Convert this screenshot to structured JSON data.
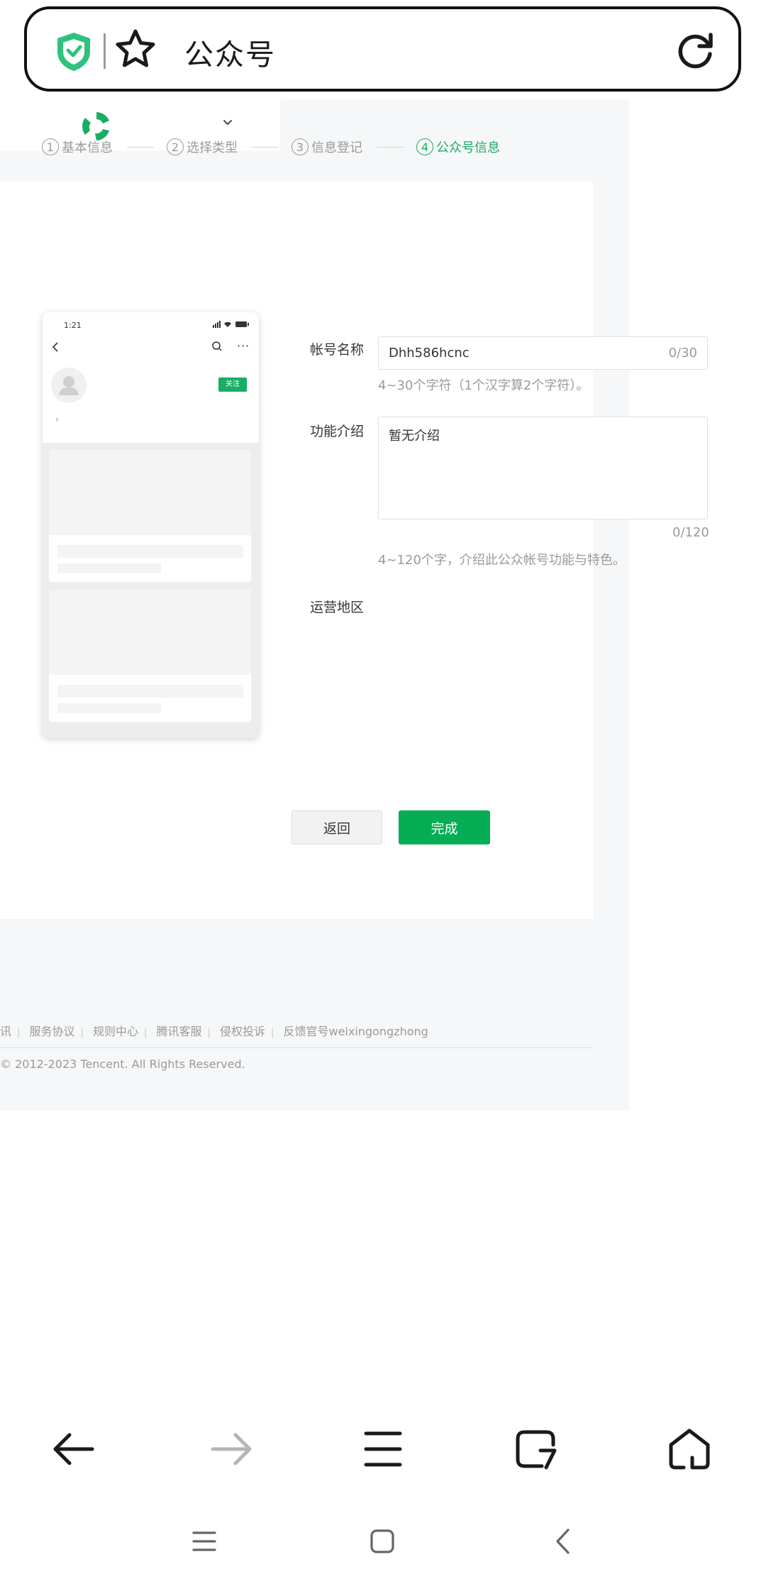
{
  "browser": {
    "address_title": "公众号"
  },
  "steps": [
    {
      "num": "1",
      "label": "基本信息"
    },
    {
      "num": "2",
      "label": "选择类型"
    },
    {
      "num": "3",
      "label": "信息登记"
    },
    {
      "num": "4",
      "label": "公众号信息"
    }
  ],
  "phone_preview": {
    "time": "1:21",
    "follow_label": "关注",
    "chevron": "›"
  },
  "form": {
    "account_name_label": "帐号名称",
    "account_name_value": "Dhh586hcnc",
    "account_name_count": "0/30",
    "account_name_hint": "4~30个字符（1个汉字算2个字符）。",
    "intro_label": "功能介绍",
    "intro_value": "暂无介绍",
    "intro_count": "0/120",
    "intro_hint": "4~120个字，介绍此公众帐号功能与特色。",
    "region_label": "运营地区"
  },
  "buttons": {
    "back": "返回",
    "done": "完成"
  },
  "footer": {
    "links": [
      "讯",
      "服务协议",
      "规则中心",
      "腾讯客服",
      "侵权投诉",
      "反馈官号weixingongzhong"
    ],
    "copyright": "© 2012-2023 Tencent. All Rights Reserved."
  },
  "colors": {
    "accent_green": "#07ad55",
    "step_active": "#1aad64"
  }
}
